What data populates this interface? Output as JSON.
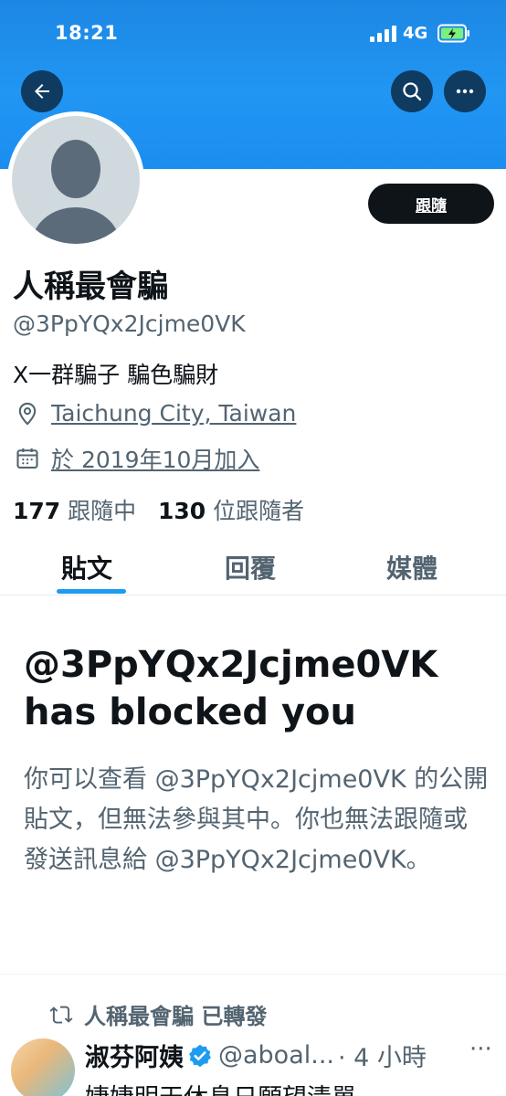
{
  "status_bar": {
    "time": "18:21",
    "network": "4G"
  },
  "header": {
    "back_icon": "arrow-left-icon",
    "search_icon": "search-icon",
    "more_icon": "more-horizontal-icon"
  },
  "profile": {
    "display_name": "人稱最會騙",
    "handle": "@3PpYQx2Jcjme0VK",
    "bio": "X一群騙子 騙色騙財",
    "location": "Taichung City, Taiwan",
    "joined": "於 2019年10月加入",
    "following_count": "177",
    "following_label": "跟隨中",
    "followers_count": "130",
    "followers_label": "位跟隨者",
    "follow_button": "跟隨"
  },
  "tabs": [
    {
      "label": "貼文",
      "active": true
    },
    {
      "label": "回覆",
      "active": false
    },
    {
      "label": "媒體",
      "active": false
    }
  ],
  "blocked": {
    "title": "@3PpYQx2Jcjme0VK has blocked you",
    "description": "你可以查看 @3PpYQx2Jcjme0VK 的公開貼文，但無法參與其中。你也無法跟隨或發送訊息給 @3PpYQx2Jcjme0VK。"
  },
  "tweet": {
    "retweet_label": "人稱最會騙 已轉發",
    "author_name": "淑芬阿姨",
    "author_handle": "@aboal...",
    "time": "· 4 小時",
    "more": "···",
    "text_preview": "婕婕明天休息日願望清單"
  },
  "colors": {
    "banner": "#1d8ce8",
    "accent": "#1d9bf0",
    "text_primary": "#0f1419",
    "text_secondary": "#536471"
  }
}
